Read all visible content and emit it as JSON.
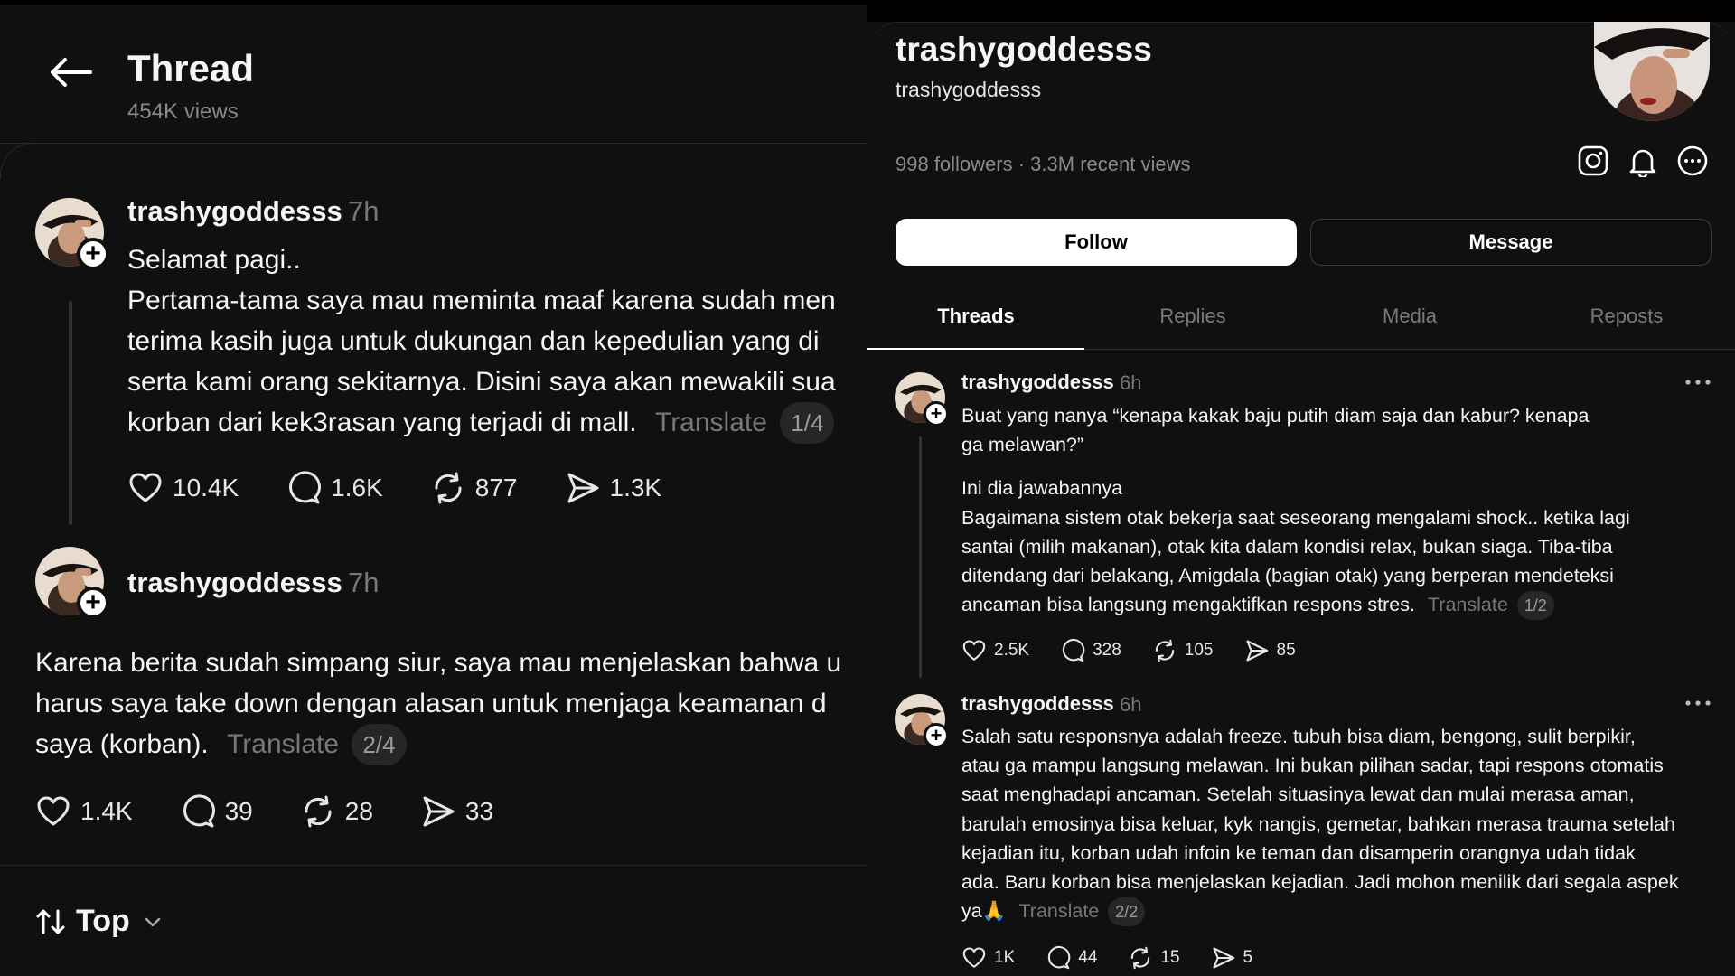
{
  "thread": {
    "title": "Thread",
    "views": "454K views",
    "sort_label": "Top",
    "posts": [
      {
        "username": "trashygoddesss",
        "time": "7h",
        "lines": [
          "Selamat pagi..",
          "Pertama-tama saya mau meminta maaf karena sudah men",
          "terima kasih juga untuk dukungan dan kepedulian yang di",
          "serta kami orang sekitarnya. Disini saya akan mewakili sua",
          "korban dari kek3rasan yang terjadi di mall."
        ],
        "translate": "Translate",
        "page": "1/4",
        "likes": "10.4K",
        "replies": "1.6K",
        "reposts": "877",
        "shares": "1.3K"
      },
      {
        "username": "trashygoddesss",
        "time": "7h",
        "lines": [
          "Karena berita sudah simpang siur, saya mau menjelaskan bahwa u",
          "harus saya take down dengan alasan untuk menjaga keamanan d",
          "saya (korban)."
        ],
        "translate": "Translate",
        "page": "2/4",
        "likes": "1.4K",
        "replies": "39",
        "reposts": "28",
        "shares": "33"
      }
    ]
  },
  "profile": {
    "name": "trashygoddesss",
    "handle": "trashygoddesss",
    "stats": "998 followers · 3.3M recent views",
    "follow_label": "Follow",
    "message_label": "Message",
    "tabs": [
      "Threads",
      "Replies",
      "Media",
      "Reposts"
    ],
    "posts": [
      {
        "username": "trashygoddesss",
        "time": "6h",
        "lines": [
          "Buat yang nanya “kenapa kakak baju putih diam saja dan kabur? kenapa",
          "ga melawan?”",
          "",
          "Ini dia jawabannya",
          "Bagaimana sistem otak bekerja saat seseorang mengalami shock.. ketika lagi",
          "santai (milih makanan), otak kita dalam kondisi relax, bukan siaga. Tiba-tiba",
          "ditendang dari belakang, Amigdala (bagian otak) yang berperan mendeteksi",
          "ancaman bisa langsung mengaktifkan respons stres."
        ],
        "translate": "Translate",
        "page": "1/2",
        "likes": "2.5K",
        "replies": "328",
        "reposts": "105",
        "shares": "85"
      },
      {
        "username": "trashygoddesss",
        "time": "6h",
        "lines": [
          "Salah satu responsnya adalah freeze. tubuh bisa diam, bengong, sulit berpikir,",
          "atau ga mampu langsung melawan. Ini bukan pilihan sadar, tapi respons otomatis",
          "saat menghadapi ancaman. Setelah situasinya lewat dan mulai merasa aman,",
          "barulah emosinya bisa keluar, kyk nangis, gemetar, bahkan merasa trauma setelah",
          "kejadian itu, korban udah infoin ke teman dan disamperin orangnya udah tidak",
          "ada. Baru korban bisa menjelaskan kejadian. Jadi mohon menilik dari segala aspek",
          "ya🙏"
        ],
        "translate": "Translate",
        "page": "2/2",
        "likes": "1K",
        "replies": "44",
        "reposts": "15",
        "shares": "5"
      }
    ]
  }
}
